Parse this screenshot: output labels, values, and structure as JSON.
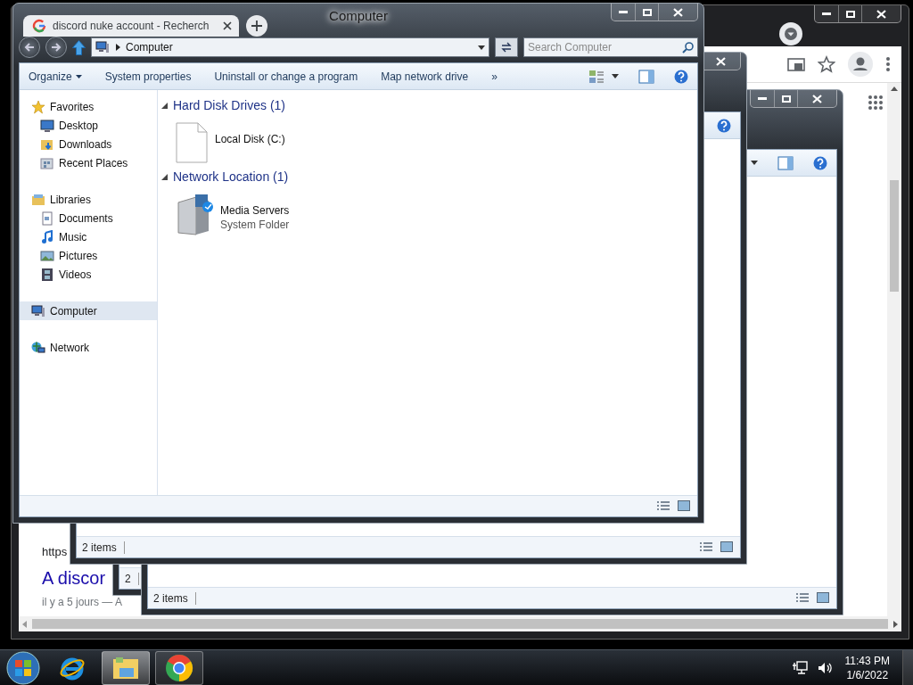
{
  "explorer_windows": [
    {
      "title": "Computer",
      "address": "Computer",
      "search_placeholder": "Search Computer",
      "toolbar": [
        {
          "label": "Organize",
          "dropdown": true
        },
        {
          "label": "System properties",
          "dropdown": false
        },
        {
          "label": "Uninstall or change a program",
          "dropdown": false
        },
        {
          "label": "Map network drive",
          "dropdown": false
        }
      ],
      "toolbar_overflow": "»",
      "sidebar": [
        {
          "label": "Favorites",
          "selected": false,
          "children": [
            {
              "label": "Desktop",
              "selected": false
            },
            {
              "label": "Downloads",
              "selected": false
            },
            {
              "label": "Recent Places",
              "selected": false
            }
          ]
        },
        {
          "label": "Libraries",
          "selected": false,
          "children": [
            {
              "label": "Documents",
              "selected": false
            },
            {
              "label": "Music",
              "selected": false
            },
            {
              "label": "Pictures",
              "selected": false
            },
            {
              "label": "Videos",
              "selected": false
            }
          ]
        },
        {
          "label": "Computer",
          "selected": true
        },
        {
          "label": "Network",
          "selected": false
        }
      ],
      "content_groups": [
        {
          "title": "Hard Disk Drives (1)",
          "expanded": true,
          "items": [
            {
              "kind": "blank-page",
              "name": "Local Disk (C:)"
            }
          ]
        },
        {
          "title": "Network Location (1)",
          "expanded": true,
          "items": [
            {
              "kind": "media-server",
              "name": "Media Servers",
              "detail": "System Folder"
            }
          ]
        }
      ]
    },
    {
      "status": "2 items"
    },
    {
      "status": "2"
    },
    {
      "status": "2 items"
    }
  ],
  "browser": {
    "tab_title": "discord nuke account - Recherch",
    "results": [
      {
        "kind": "url",
        "text": "https"
      },
      {
        "kind": "title",
        "text": "A discor"
      },
      {
        "kind": "snippet",
        "text": "il y a 5 jours — A"
      }
    ]
  },
  "taskbar": {
    "apps": [
      {
        "kind": "ie",
        "running": false,
        "active": false
      },
      {
        "kind": "explorer",
        "running": true,
        "active": true
      },
      {
        "kind": "chrome",
        "running": true,
        "active": false
      }
    ],
    "time": "11:43 PM",
    "date": "1/6/2022"
  }
}
